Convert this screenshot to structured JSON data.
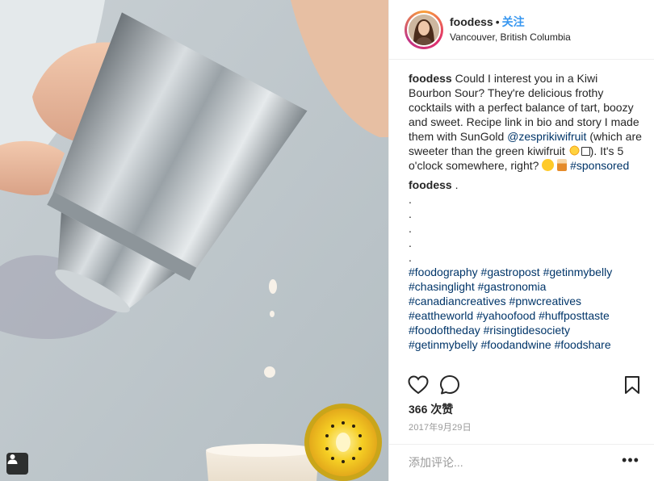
{
  "post": {
    "username": "foodess",
    "separator": "•",
    "follow_label": "关注",
    "location": "Vancouver, British Columbia",
    "caption": {
      "username": "foodess",
      "text_1": "Could I interest you in a Kiwi Bourbon Sour? They're delicious frothy cocktails with a perfect balance of tart, boozy and sweet. Recipe link in bio and story I made them with SunGold",
      "mention": "@zesprikiwifruit",
      "text_2": "(which are sweeter than the green kiwifruit",
      "text_3": "). It's 5 o'clock somewhere, right?",
      "hashtag": "#sponsored"
    },
    "comment": {
      "username": "foodess",
      "text": ".",
      "dots": [
        ".",
        ".",
        ".",
        ".",
        "."
      ],
      "hashtag_lines": [
        [
          "#foodography",
          "#gastropost",
          "#getinmybelly"
        ],
        [
          "#chasinglight",
          "#gastronomia"
        ],
        [
          "#canadiancreatives",
          "#pnwcreatives"
        ],
        [
          "#eattheworld",
          "#yahoofood",
          "#huffposttaste"
        ],
        [
          "#foodoftheday",
          "#risingtidesociety"
        ],
        [
          "#getinmybelly",
          "#foodandwine",
          "#foodshare"
        ]
      ]
    },
    "likes_label": "366 次赞",
    "date": "2017年9月29日",
    "comment_placeholder": "添加评论...",
    "more_label": "•••"
  },
  "icons": {
    "like": "heart-icon",
    "comment": "comment-bubble-icon",
    "save": "bookmark-icon",
    "tagged": "user-tag-icon"
  },
  "colors": {
    "follow": "#3897f0",
    "link": "#003569",
    "muted": "#999999",
    "border": "#efefef"
  }
}
